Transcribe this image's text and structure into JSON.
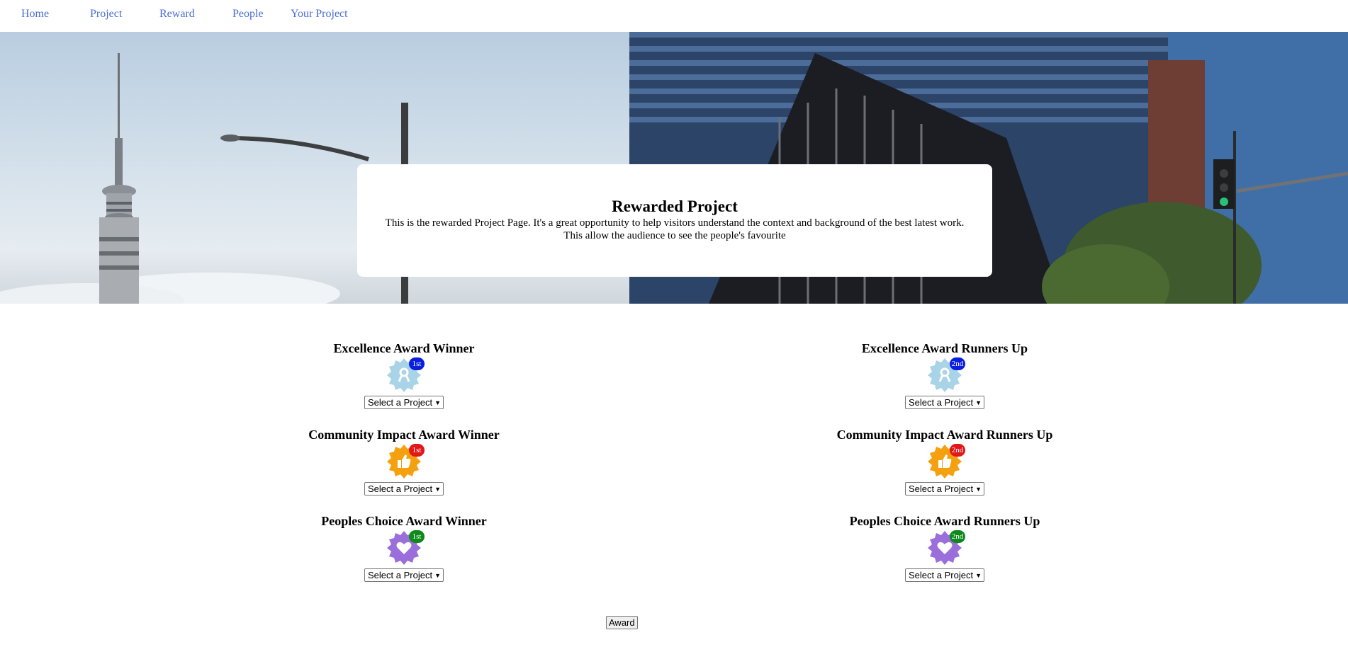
{
  "nav": {
    "items": [
      {
        "label": "Home"
      },
      {
        "label": "Project"
      },
      {
        "label": "Reward"
      },
      {
        "label": "People"
      },
      {
        "label": "Your Project"
      }
    ]
  },
  "hero": {
    "title": "Rewarded Project",
    "description": "This is the rewarded Project Page. It's a great opportunity to help visitors understand the context and background of the best latest work. This allow the audience to see the people's favourite"
  },
  "awards": {
    "excellence_winner": {
      "title": "Excellence Award Winner",
      "rank": "1st",
      "icon": "ribbon-badge-icon",
      "badge_color": "#a9d3e6",
      "rank_color": "#0a1ee0",
      "select": "Select a Project"
    },
    "excellence_runner": {
      "title": "Excellence Award Runners Up",
      "rank": "2nd",
      "icon": "ribbon-badge-icon",
      "badge_color": "#a9d3e6",
      "rank_color": "#0a1ee0",
      "select": "Select a Project"
    },
    "community_winner": {
      "title": "Community Impact Award Winner",
      "rank": "1st",
      "icon": "thumbs-up-badge-icon",
      "badge_color": "#f5a00e",
      "rank_color": "#e21717",
      "select": "Select a Project"
    },
    "community_runner": {
      "title": "Community Impact Award Runners Up",
      "rank": "2nd",
      "icon": "thumbs-up-badge-icon",
      "badge_color": "#f5a00e",
      "rank_color": "#e21717",
      "select": "Select a Project"
    },
    "peoples_winner": {
      "title": "Peoples Choice Award Winner",
      "rank": "1st",
      "icon": "heart-badge-icon",
      "badge_color": "#9a6fdc",
      "rank_color": "#0d8a1a",
      "select": "Select a Project"
    },
    "peoples_runner": {
      "title": "Peoples Choice Award Runners Up",
      "rank": "2nd",
      "icon": "heart-badge-icon",
      "badge_color": "#9a6fdc",
      "rank_color": "#0d8a1a",
      "select": "Select a Project"
    }
  },
  "submit_label": "Award"
}
